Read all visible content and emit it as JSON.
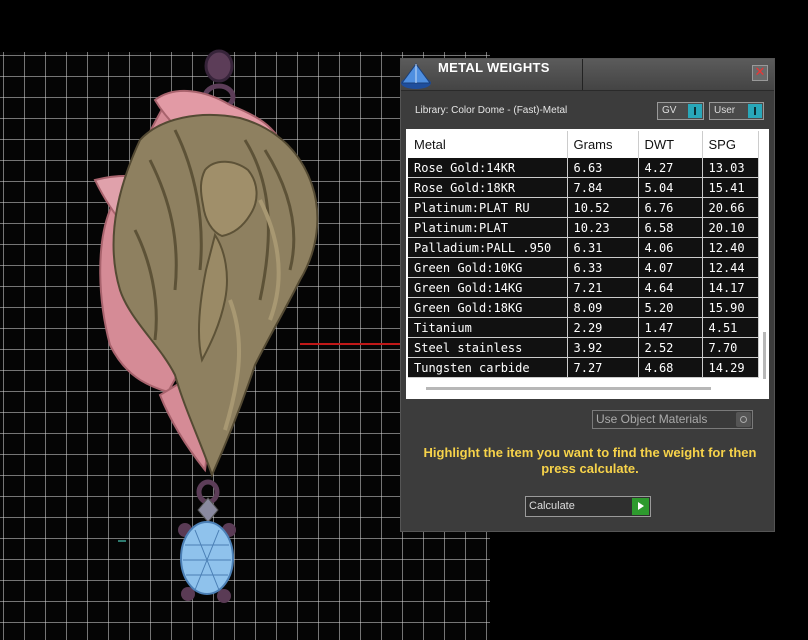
{
  "panel": {
    "title": "METAL WEIGHTS",
    "close_glyph": "✕",
    "library_label": "Library: Color Dome - (Fast)-Metal",
    "toggles": {
      "gv": "GV",
      "user": "User"
    },
    "use_object_materials": "Use Object Materials",
    "hint": "Highlight the item you want to find the weight for then press calculate.",
    "calculate_label": "Calculate"
  },
  "table": {
    "headers": [
      "Metal",
      "Grams",
      "DWT",
      "SPG"
    ],
    "rows": [
      [
        "Rose Gold:14KR",
        "6.63",
        "4.27",
        "13.03"
      ],
      [
        "Rose Gold:18KR",
        "7.84",
        "5.04",
        "15.41"
      ],
      [
        "Platinum:PLAT RU",
        "10.52",
        "6.76",
        "20.66"
      ],
      [
        "Platinum:PLAT",
        "10.23",
        "6.58",
        "20.10"
      ],
      [
        "Palladium:PALL .950",
        "6.31",
        "4.06",
        "12.40"
      ],
      [
        "Green Gold:10KG",
        "6.33",
        "4.07",
        "12.44"
      ],
      [
        "Green Gold:14KG",
        "7.21",
        "4.64",
        "14.17"
      ],
      [
        "Green Gold:18KG",
        "8.09",
        "5.20",
        "15.90"
      ],
      [
        "Titanium",
        "2.29",
        "1.47",
        "4.51"
      ],
      [
        "Steel stainless",
        "3.92",
        "2.52",
        "7.70"
      ],
      [
        "Tungsten carbide",
        "7.27",
        "4.68",
        "14.29"
      ]
    ]
  },
  "colors": {
    "hint_text": "#f7d34a",
    "toggle_accent": "#29a7b9",
    "calculate_go": "#2e9a2e",
    "axis_red": "#c01818",
    "model_gold": "#8e8060",
    "model_pink": "#d58b96",
    "gem_blue": "#8fc2ec",
    "prong_purple": "#5a3b55"
  },
  "icons": {
    "app": "cone-dome-icon",
    "close": "close-icon",
    "gv_toggle": "toggle-knob-icon",
    "user_toggle": "toggle-knob-icon",
    "use_materials": "radio-knob-icon",
    "calculate": "play-arrow-icon"
  }
}
